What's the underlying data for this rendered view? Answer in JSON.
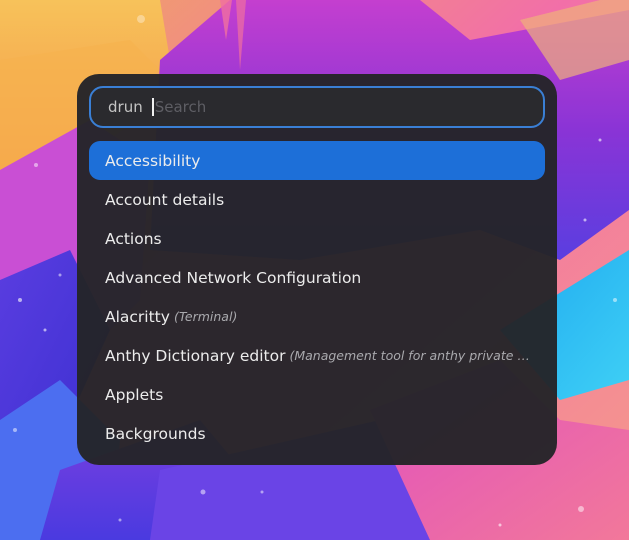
{
  "launcher": {
    "mode_label": "drun",
    "search": {
      "value": "",
      "placeholder": "Search"
    },
    "results": [
      {
        "name": "Accessibility",
        "description": "",
        "selected": true
      },
      {
        "name": "Account details",
        "description": "",
        "selected": false
      },
      {
        "name": "Actions",
        "description": "",
        "selected": false
      },
      {
        "name": "Advanced Network Configuration",
        "description": "",
        "selected": false
      },
      {
        "name": "Alacritty",
        "description": "(Terminal)",
        "selected": false
      },
      {
        "name": "Anthy Dictionary editor",
        "description": "(Management tool for anthy private dictionary)",
        "selected": false
      },
      {
        "name": "Applets",
        "description": "",
        "selected": false
      },
      {
        "name": "Backgrounds",
        "description": "",
        "selected": false
      }
    ]
  },
  "colors": {
    "accent": "#1d6fd8",
    "search_border": "#3a7fd5",
    "panel_background": "#242428"
  }
}
